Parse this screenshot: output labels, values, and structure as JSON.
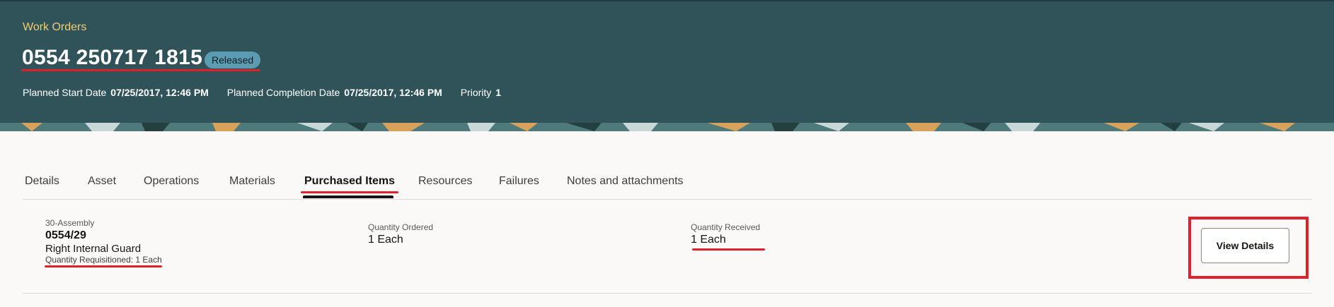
{
  "header": {
    "breadcrumb": "Work Orders",
    "title": "0554 250717 1815",
    "status": "Released",
    "planned_start_label": "Planned Start Date",
    "planned_start_value": "07/25/2017, 12:46 PM",
    "planned_completion_label": "Planned Completion Date",
    "planned_completion_value": "07/25/2017, 12:46 PM",
    "priority_label": "Priority",
    "priority_value": "1"
  },
  "tabs": [
    {
      "label": "Details"
    },
    {
      "label": "Asset"
    },
    {
      "label": "Operations"
    },
    {
      "label": "Materials"
    },
    {
      "label": "Purchased Items",
      "active": true
    },
    {
      "label": "Resources"
    },
    {
      "label": "Failures"
    },
    {
      "label": "Notes and attachments"
    }
  ],
  "purchased_item": {
    "operation": "30-Assembly",
    "item_number": "0554/29",
    "description": "Right Internal Guard",
    "quantity_requisitioned": "Quantity Requisitioned: 1 Each",
    "quantity_ordered_label": "Quantity Ordered",
    "quantity_ordered_value": "1 Each",
    "quantity_received_label": "Quantity Received",
    "quantity_received_value": "1 Each",
    "view_details_label": "View Details"
  },
  "colors": {
    "header_bg": "#30535a",
    "breadcrumb": "#f0cc71",
    "status_badge": "#5b9cb2",
    "annotation_red": "#e0202a"
  }
}
